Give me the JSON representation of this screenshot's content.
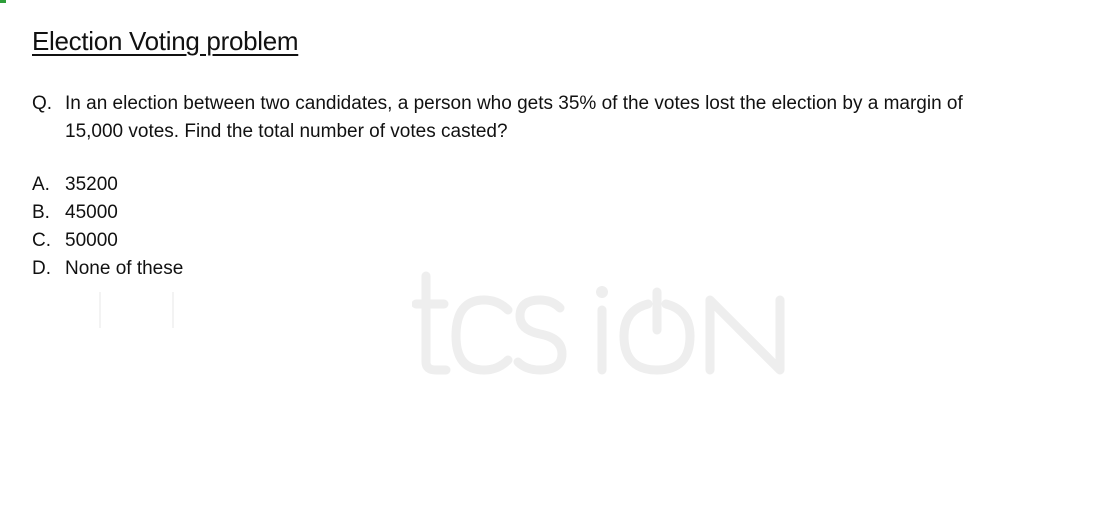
{
  "title": "Election Voting problem",
  "question": {
    "label": "Q.",
    "line1": "In  an election between two candidates, a person who gets 35% of the votes lost the election by a margin of",
    "line2": "15,000 votes. Find the total number of votes casted?"
  },
  "options": [
    {
      "letter": "A.",
      "text": "35200"
    },
    {
      "letter": "B.",
      "text": "45000"
    },
    {
      "letter": "C.",
      "text": "50000"
    },
    {
      "letter": "D.",
      "text": "None of these"
    }
  ],
  "watermark": {
    "text": "tcs iON",
    "color": "#eeeeee"
  },
  "colors": {
    "text": "#111111",
    "corner_mark": "#2e9e3a",
    "background": "#ffffff"
  }
}
